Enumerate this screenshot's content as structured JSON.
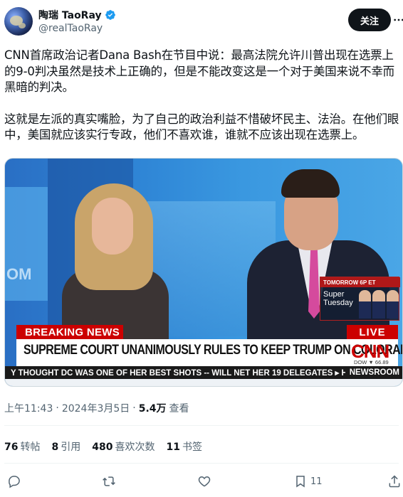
{
  "author": {
    "display_name": "陶瑞 TaoRay",
    "handle": "@realTaoRay",
    "verified_badge_color": "#1d9bf0"
  },
  "follow_button": {
    "label": "关注"
  },
  "more_icon": "more-horizontal-icon",
  "tweet": {
    "paragraph1": "CNN首席政治记者Dana Bash在节目中说：最高法院允许川普出现在选票上的9-0判决虽然是技术上正确的，但是不能改变这是一个对于美国来说不幸而黑暗的判决。",
    "paragraph2": "这就是左派的真实嘴脸，为了自己的政治利益不惜破坏民主、法治。在他们眼中，美国就应该实行专政，他们不喜欢谁，谁就不应该出现在选票上。"
  },
  "media": {
    "bg_text": "OM",
    "promo_header": "TOMORROW 6P ET",
    "promo_title": "Super Tuesday",
    "breaking_label": "BREAKING NEWS",
    "live_label": "LIVE",
    "headline": "SUPREME COURT UNANIMOUSLY RULES TO KEEP TRUMP ON COLORADO BALLOT",
    "network_logo": "CNN",
    "dow_text": "DOW ▼ 66.89",
    "ticker_text": "Y THOUGHT DC WAS ONE OF HER BEST SHOTS -- WILL NET HER 19 DELEGATES  ▸ HALE",
    "ticker_brand": "NEWSROOM"
  },
  "meta": {
    "time": "上午11:43",
    "separator": "·",
    "date": "2024年3月5日",
    "views": "5.4万",
    "views_label": "查看"
  },
  "stats": [
    {
      "count": "76",
      "label": "转帖"
    },
    {
      "count": "8",
      "label": "引用"
    },
    {
      "count": "480",
      "label": "喜欢次数"
    },
    {
      "count": "11",
      "label": "书签"
    }
  ],
  "actions": {
    "bookmark_count": "11"
  },
  "colors": {
    "text_primary": "#0f1419",
    "text_secondary": "#536471",
    "cnn_red": "#cc0000"
  }
}
